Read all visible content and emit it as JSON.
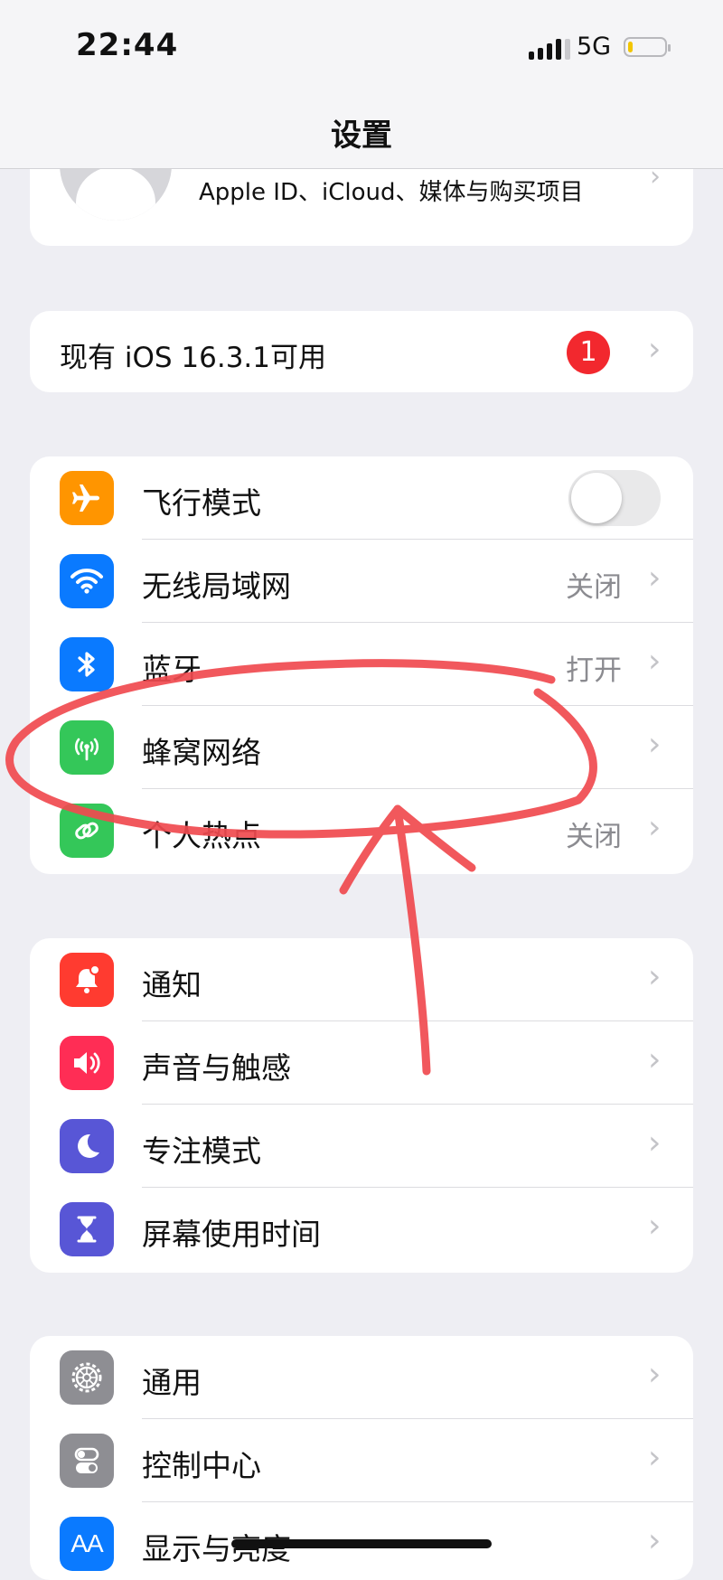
{
  "status_bar": {
    "time": "22:44",
    "network": "5G",
    "signal_icon": "cellular-signal-icon",
    "battery_level": 0.12,
    "battery_color": "#f2c500"
  },
  "nav": {
    "title": "设置"
  },
  "apple_id": {
    "subtitle": "Apple ID、iCloud、媒体与购买项目"
  },
  "update": {
    "text": "现有 iOS 16.3.1可用",
    "badge": "1",
    "badge_color": "#f2282e"
  },
  "network_group": [
    {
      "label": "飞行模式",
      "icon": "airplane-icon",
      "color": "#ff9500",
      "toggle": "off"
    },
    {
      "label": "无线局域网",
      "icon": "wifi-icon",
      "color": "#0a7aff",
      "value": "关闭"
    },
    {
      "label": "蓝牙",
      "icon": "bluetooth-icon",
      "color": "#0a7aff",
      "value": "打开"
    },
    {
      "label": "蜂窝网络",
      "icon": "cellular-antenna-icon",
      "color": "#34c759"
    },
    {
      "label": "个人热点",
      "icon": "hotspot-icon",
      "color": "#34c759",
      "value": "关闭"
    }
  ],
  "notify_group": [
    {
      "label": "通知",
      "icon": "notification-bell-icon",
      "color": "#ff3b30"
    },
    {
      "label": "声音与触感",
      "icon": "speaker-icon",
      "color": "#ff2d55"
    },
    {
      "label": "专注模式",
      "icon": "moon-icon",
      "color": "#5856d6"
    },
    {
      "label": "屏幕使用时间",
      "icon": "hourglass-icon",
      "color": "#5856d6"
    }
  ],
  "general_group": [
    {
      "label": "通用",
      "icon": "gear-icon",
      "color": "#8e8e93"
    },
    {
      "label": "控制中心",
      "icon": "toggle-switches-icon",
      "color": "#8e8e93"
    },
    {
      "label": "显示与亮度",
      "icon": "aa-text-icon",
      "icon_text": "AA",
      "color": "#0a7aff"
    }
  ],
  "chevron": "›",
  "annotation_color": "#f04a4f"
}
